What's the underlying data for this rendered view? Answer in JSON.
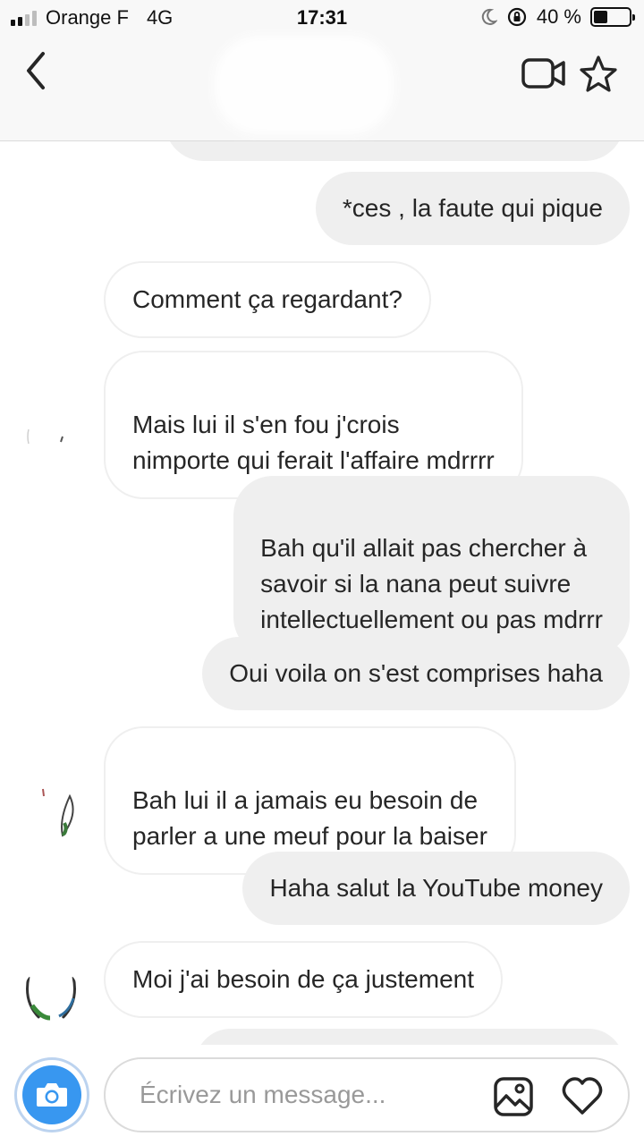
{
  "status_bar": {
    "carrier": "Orange F",
    "network": "4G",
    "time": "17:31",
    "battery_text": "40 %",
    "battery_level": 0.4
  },
  "header": {
    "contact_name": "",
    "icons": {
      "back": "chevron-left-icon",
      "video": "video-camera-icon",
      "star": "star-icon"
    }
  },
  "messages": [
    {
      "direction": "out",
      "text": "*ces , la faute qui pique"
    },
    {
      "direction": "in",
      "text": "Comment ça regardant?"
    },
    {
      "direction": "in",
      "text": "Mais lui il s'en fou j'crois\nnimporte qui ferait l'affaire mdrrrr"
    },
    {
      "direction": "out",
      "text": "Bah qu'il allait pas chercher à\nsavoir si la nana peut suivre\nintellectuellement ou pas mdrrr"
    },
    {
      "direction": "out",
      "text": "Oui voila on s'est comprises haha"
    },
    {
      "direction": "in",
      "text": "Bah lui il a jamais eu besoin de\nparler a une meuf pour la baiser"
    },
    {
      "direction": "out",
      "text": "Haha salut la YouTube money"
    },
    {
      "direction": "in",
      "text": "Moi j'ai besoin de ça justement"
    }
  ],
  "composer": {
    "placeholder": "Écrivez un message...",
    "icons": {
      "camera": "camera-icon",
      "gallery": "gallery-icon",
      "heart": "heart-icon"
    }
  },
  "colors": {
    "accent": "#3897f0",
    "incoming_bubble": "#ffffff",
    "outgoing_bubble": "#efefef",
    "header_bg": "#f8f8f8"
  }
}
